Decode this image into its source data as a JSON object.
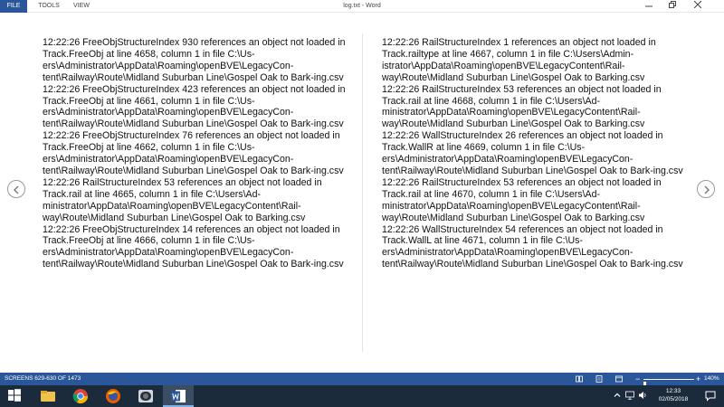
{
  "ribbon": {
    "tabs": [
      {
        "label": "FILE"
      },
      {
        "label": "TOOLS"
      },
      {
        "label": "VIEW"
      }
    ],
    "document_title": "log.txt - Word"
  },
  "document": {
    "left_column": [
      "12:22:26  FreeObjStructureIndex 930 references an object not loaded in Track.FreeObj at line 4658, column 1 in file C:\\Us-ers\\Administrator\\AppData\\Roaming\\openBVE\\LegacyCon-tent\\Railway\\Route\\Midland Suburban Line\\Gospel Oak to Bark-ing.csv",
      "12:22:26  FreeObjStructureIndex 423 references an object not loaded in Track.FreeObj at line 4661, column 1 in file C:\\Us-ers\\Administrator\\AppData\\Roaming\\openBVE\\LegacyCon-tent\\Railway\\Route\\Midland Suburban Line\\Gospel Oak to Bark-ing.csv",
      "12:22:26  FreeObjStructureIndex 76 references an object not loaded in Track.FreeObj at line 4662, column 1 in file C:\\Us-ers\\Administrator\\AppData\\Roaming\\openBVE\\LegacyCon-tent\\Railway\\Route\\Midland Suburban Line\\Gospel Oak to Bark-ing.csv",
      "12:22:26  RailStructureIndex 53 references an object not loaded in Track.rail at line 4665, column 1 in file C:\\Users\\Ad-ministrator\\AppData\\Roaming\\openBVE\\LegacyContent\\Rail-way\\Route\\Midland Suburban Line\\Gospel Oak to Barking.csv",
      "12:22:26  FreeObjStructureIndex 14 references an object not loaded in Track.FreeObj at line 4666, column 1 in file C:\\Us-ers\\Administrator\\AppData\\Roaming\\openBVE\\LegacyCon-tent\\Railway\\Route\\Midland Suburban Line\\Gospel Oak to Bark-ing.csv"
    ],
    "right_column": [
      "12:22:26  RailStructureIndex 1 references an object not loaded in Track.railtype at line 4667, column 1 in file C:\\Users\\Admin-istrator\\AppData\\Roaming\\openBVE\\LegacyContent\\Rail-way\\Route\\Midland Suburban Line\\Gospel Oak to Barking.csv",
      "12:22:26  RailStructureIndex 53 references an object not loaded in Track.rail at line 4668, column 1 in file C:\\Users\\Ad-ministrator\\AppData\\Roaming\\openBVE\\LegacyContent\\Rail-way\\Route\\Midland Suburban Line\\Gospel Oak to Barking.csv",
      "12:22:26  WallStructureIndex 26 references an object not loaded in Track.WallR at line 4669, column 1 in file C:\\Us-ers\\Administrator\\AppData\\Roaming\\openBVE\\LegacyCon-tent\\Railway\\Route\\Midland Suburban Line\\Gospel Oak to Bark-ing.csv",
      "12:22:26  RailStructureIndex 53 references an object not loaded in Track.rail at line 4670, column 1 in file C:\\Users\\Ad-ministrator\\AppData\\Roaming\\openBVE\\LegacyContent\\Rail-way\\Route\\Midland Suburban Line\\Gospel Oak to Barking.csv",
      "12:22:26  WallStructureIndex 54 references an object not loaded in Track.WallL at line 4671, column 1 in file C:\\Us-ers\\Administrator\\AppData\\Roaming\\openBVE\\LegacyCon-tent\\Railway\\Route\\Midland Suburban Line\\Gospel Oak to Bark-ing.csv"
    ]
  },
  "statusbar": {
    "screens": "SCREENS 629-630 OF 1473",
    "zoom_minus": "−",
    "zoom_plus": "+",
    "zoom_level": "140%"
  },
  "taskbar": {
    "time": "12:33",
    "date": "02/05/2018",
    "apps": [
      "file-explorer-icon",
      "chrome-icon",
      "firefox-icon",
      "app-window-icon",
      "word-icon"
    ]
  },
  "colors": {
    "word_blue": "#2b579a",
    "taskbar": "#1c2b3c"
  }
}
